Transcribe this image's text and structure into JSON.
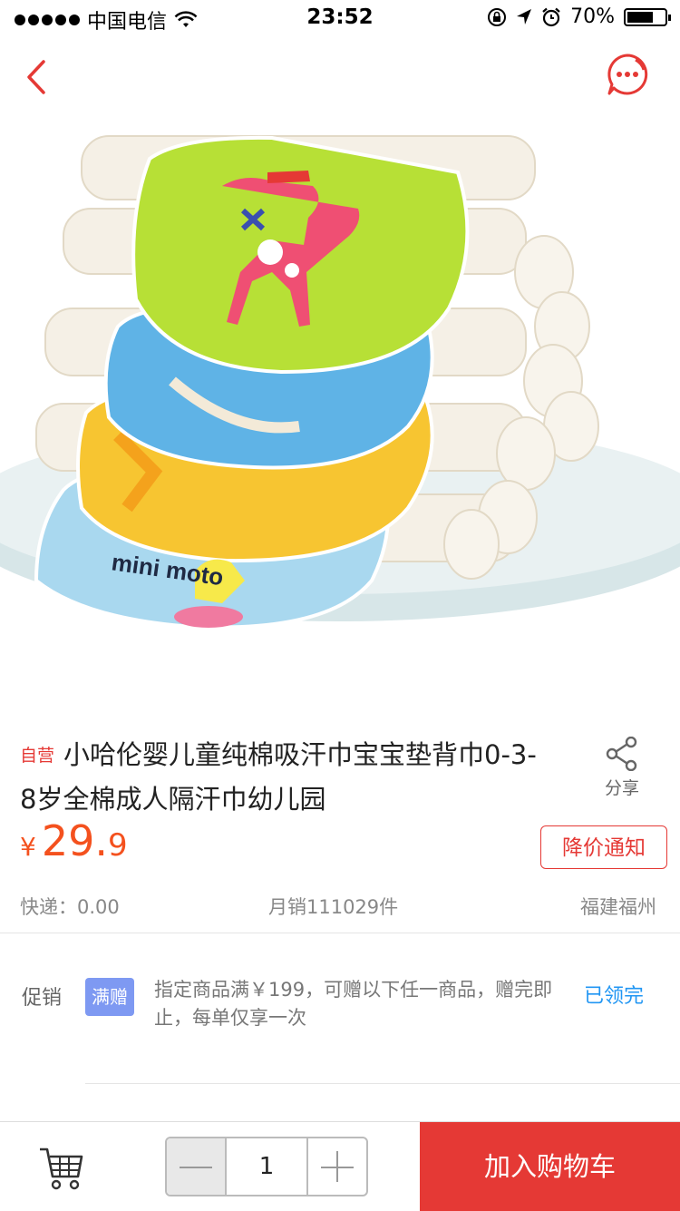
{
  "status_bar": {
    "carrier": "中国电信",
    "time": "23:52",
    "battery_text": "70%",
    "battery_level": 0.7
  },
  "nav": {
    "back_icon": "chevron-left-icon",
    "more_icon": "chat-more-icon",
    "accent": "#e53935"
  },
  "product_image": {
    "brand_text": "mini moto"
  },
  "product": {
    "self_operated_tag": "自营",
    "title": "小哈伦婴儿童纯棉吸汗巾宝宝垫背巾0-3-8岁全棉成人隔汗巾幼儿园",
    "price_symbol": "¥",
    "price_integer": "29.",
    "price_decimal": "9",
    "price_alert_label": "降价通知",
    "share_label": "分享",
    "shipping": "快递：0.00",
    "monthly_sales": "月销111029件",
    "location": "福建福州"
  },
  "promotion": {
    "label": "促销",
    "badge": "满赠",
    "text": "指定商品满￥199，可赠以下任一商品，赠完即止，每单仅享一次",
    "status": "已领完"
  },
  "bottom_bar": {
    "cart_icon": "shopping-cart-icon",
    "quantity": "1",
    "add_to_cart_label": "加入购物车"
  }
}
